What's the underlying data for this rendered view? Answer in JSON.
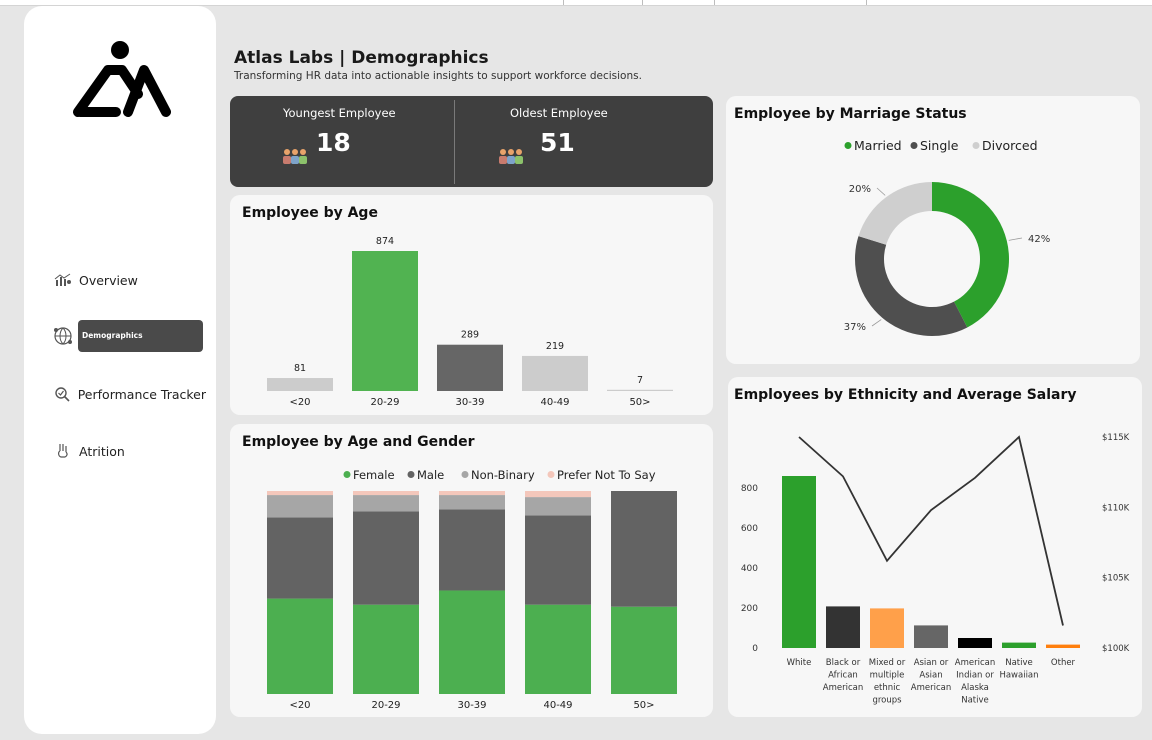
{
  "header": {
    "title": "Atlas Labs | Demographics",
    "subtitle": "Transforming HR data into actionable insights to support workforce decisions."
  },
  "nav": {
    "items": [
      {
        "label": "Overview",
        "icon": "chart-people-icon",
        "active": false
      },
      {
        "label": "Demographics",
        "icon": "globe-people-icon",
        "active": true
      },
      {
        "label": "Performance Tracker",
        "icon": "magnifier-check-icon",
        "active": false
      },
      {
        "label": "Atrition",
        "icon": "hand-down-icon",
        "active": false
      }
    ]
  },
  "kpis": {
    "youngest_label": "Youngest Employee",
    "youngest_value": "18",
    "oldest_label": "Oldest Employee",
    "oldest_value": "51"
  },
  "colors": {
    "green": "#2ca02c",
    "lightgreen": "#51b351",
    "darkgray": "#4f4f4f",
    "midgray": "#6a6a6a",
    "lightgray": "#cccccc",
    "peach": "#f4c7bb",
    "orange": "#ffa04a"
  },
  "chart_data": [
    {
      "id": "age",
      "type": "bar",
      "title": "Employee by Age",
      "categories": [
        "<20",
        "20-29",
        "30-39",
        "40-49",
        "50>"
      ],
      "values": [
        81,
        874,
        289,
        219,
        7
      ],
      "colors": [
        "#cccccc",
        "#51b351",
        "#666666",
        "#cccccc",
        "#cccccc"
      ]
    },
    {
      "id": "age_gender",
      "type": "bar",
      "stacked": true,
      "normalized": true,
      "title": "Employee by Age and Gender",
      "categories": [
        "<20",
        "20-29",
        "30-39",
        "40-49",
        "50>"
      ],
      "series": [
        {
          "name": "Female",
          "color": "#4caf50",
          "values": [
            47,
            44,
            51,
            44,
            43
          ]
        },
        {
          "name": "Male",
          "color": "#636363",
          "values": [
            40,
            46,
            40,
            44,
            57
          ]
        },
        {
          "name": "Non-Binary",
          "color": "#a6a6a6",
          "values": [
            11,
            8,
            7,
            9,
            0
          ]
        },
        {
          "name": "Prefer Not To Say",
          "color": "#f4c7bb",
          "values": [
            2,
            2,
            2,
            3,
            0
          ]
        }
      ]
    },
    {
      "id": "marriage",
      "type": "pie",
      "donut": true,
      "title": "Employee by Marriage Status",
      "labels": [
        "Married",
        "Single",
        "Divorced"
      ],
      "values": [
        42,
        37,
        20
      ],
      "value_labels": [
        "42%",
        "37%",
        "20%"
      ],
      "colors": [
        "#2ca02c",
        "#4f4f4f",
        "#cfcfcf"
      ]
    },
    {
      "id": "ethnicity",
      "type": "bar",
      "combo_line": true,
      "title": "Employees by Ethnicity and Average Salary",
      "categories": [
        "White",
        "Black or African American",
        "Mixed or multiple ethnic groups",
        "Asian or Asian American",
        "American Indian or Alaska Native",
        "Native Hawaiian",
        "Other"
      ],
      "category_lines": [
        [
          "White"
        ],
        [
          "Black or",
          "African",
          "American"
        ],
        [
          "Mixed or",
          "multiple",
          "ethnic",
          "groups"
        ],
        [
          "Asian or",
          "Asian",
          "American"
        ],
        [
          "American",
          "Indian or",
          "Alaska",
          "Native"
        ],
        [
          "Native",
          "Hawaiian"
        ],
        [
          "Other"
        ]
      ],
      "bar_values": [
        860,
        208,
        198,
        113,
        50,
        27,
        17
      ],
      "bar_colors": [
        "#2ca02c",
        "#333333",
        "#ffa04a",
        "#666666",
        "#000000",
        "#2ca02c",
        "#ff7f0e"
      ],
      "line_values": [
        115000,
        112200,
        106200,
        109800,
        112100,
        115000,
        101600
      ],
      "y_left_ticks": [
        "0",
        "200",
        "400",
        "600",
        "800"
      ],
      "y_left_range": [
        0,
        1000
      ],
      "y_right_ticks": [
        "$100K",
        "$105K",
        "$110K",
        "$115K"
      ],
      "y_right_range": [
        100000,
        115000
      ]
    }
  ]
}
